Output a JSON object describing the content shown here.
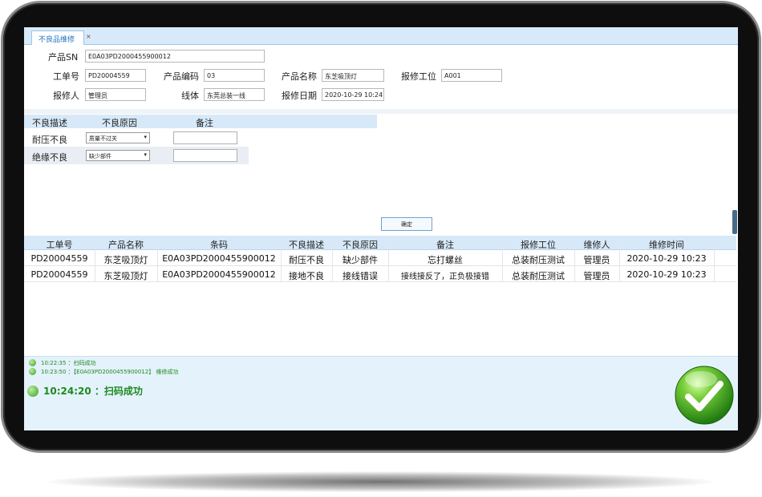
{
  "tab": {
    "label": "不良品维修",
    "close": "×"
  },
  "form": {
    "sn_label": "产品SN",
    "sn_value": "E0A03PD2000455900012",
    "order_label": "工单号",
    "order_value": "PD20004559",
    "code_label": "产品编码",
    "code_value": "03",
    "name_label": "产品名称",
    "name_value": "东芝吸顶灯",
    "station_label": "报修工位",
    "station_value": "A001",
    "reporter_label": "报修人",
    "reporter_value": "管理员",
    "line_label": "线体",
    "line_value": "东莞总装一线",
    "date_label": "报修日期",
    "date_value": "2020-10-29 10:24:08"
  },
  "defect_grid": {
    "headers": [
      "不良描述",
      "不良原因",
      "备注"
    ],
    "rows": [
      {
        "desc": "耐压不良",
        "reason": "质量不过关"
      },
      {
        "desc": "绝缘不良",
        "reason": "缺少部件"
      }
    ],
    "dropdown_arrow": "▾",
    "confirm_label": "确定"
  },
  "records": {
    "headers": [
      "工单号",
      "产品名称",
      "条码",
      "不良描述",
      "不良原因",
      "备注",
      "报修工位",
      "维修人",
      "维修时间"
    ],
    "rows": [
      [
        "PD20004559",
        "东芝吸顶灯",
        "E0A03PD2000455900012",
        "耐压不良",
        "缺少部件",
        "忘打螺丝",
        "总装耐压测试",
        "管理员",
        "2020-10-29 10:23"
      ],
      [
        "PD20004559",
        "东芝吸顶灯",
        "E0A03PD2000455900012",
        "接地不良",
        "接线错误",
        "接线接反了，正负极接错",
        "总装耐压测试",
        "管理员",
        "2020-10-29 10:23"
      ]
    ]
  },
  "log": {
    "lines": [
      "10:22:35 ：扫码成功",
      "10:23:50 ：【E0A03PD2000455900012】 维修成功"
    ],
    "latest": "10:24:20 ：扫码成功"
  },
  "colors": {
    "accent": "#1e8a1e",
    "header_bg": "#d7e9f8",
    "log_bg": "#e4f2fc"
  },
  "icons": {
    "status": "check-circle-icon"
  }
}
